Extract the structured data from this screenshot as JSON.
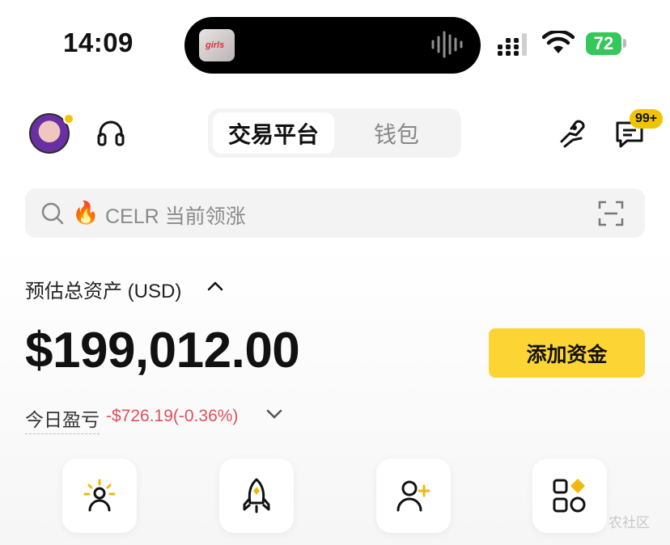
{
  "status_bar": {
    "time": "14:09",
    "island_thumbnail_text": "girls",
    "battery": "72",
    "battery_color": "#34c759"
  },
  "header": {
    "tabs": [
      {
        "label": "交易平台",
        "active": true
      },
      {
        "label": "钱包",
        "active": false
      }
    ],
    "message_badge": "99+",
    "icons": [
      "avatar",
      "headset-icon",
      "referral-icon",
      "message-icon"
    ]
  },
  "search": {
    "placeholder": "CELR 当前领涨",
    "icons": [
      "search-icon",
      "fire-icon",
      "scan-icon"
    ]
  },
  "assets": {
    "label": "预估总资产 (USD)",
    "balance": "$199,012.00",
    "add_funds_label": "添加资金",
    "pnl_label": "今日盈亏",
    "pnl_value": "-$726.19(-0.36%)",
    "accent_color": "#fcd535",
    "loss_color": "#e0505a"
  },
  "shortcuts": [
    {
      "icon": "sun-person-icon"
    },
    {
      "icon": "rocket-icon"
    },
    {
      "icon": "add-friend-icon"
    },
    {
      "icon": "more-apps-icon"
    }
  ],
  "watermark": "农社区"
}
